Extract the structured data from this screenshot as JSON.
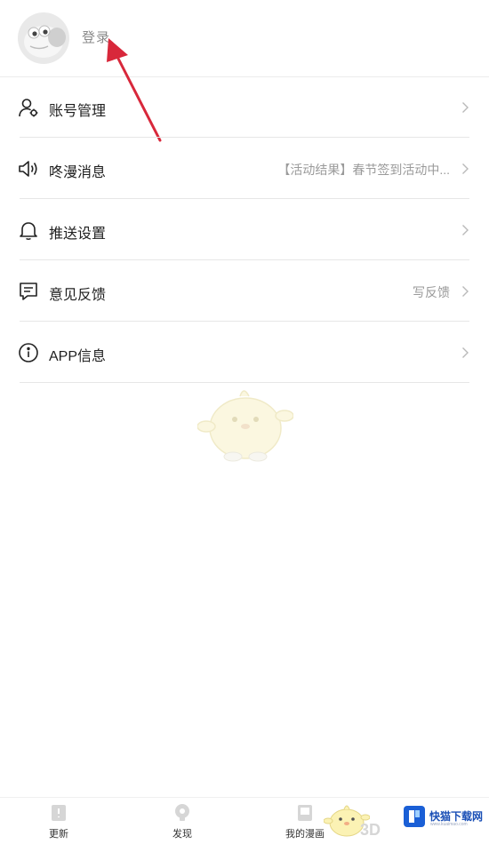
{
  "header": {
    "login_label": "登录"
  },
  "menu": [
    {
      "label": "账号管理",
      "icon": "user-settings-icon",
      "value": ""
    },
    {
      "label": "咚漫消息",
      "icon": "speaker-icon",
      "value": "【活动结果】春节签到活动中..."
    },
    {
      "label": "推送设置",
      "icon": "bell-icon",
      "value": ""
    },
    {
      "label": "意见反馈",
      "icon": "chat-message-icon",
      "value": "写反馈"
    },
    {
      "label": "APP信息",
      "icon": "info-icon",
      "value": ""
    }
  ],
  "tabbar": [
    {
      "label": "更新",
      "icon": "update-icon"
    },
    {
      "label": "发现",
      "icon": "discover-icon"
    },
    {
      "label": "我的漫画",
      "icon": "my-comics-icon"
    }
  ],
  "watermark": {
    "brand_text": "3D",
    "badge_title": "快猫下载网",
    "badge_subtitle": "www.kuaimao.com"
  },
  "colors": {
    "arrow": "#d8283b",
    "divider": "#e6e6e6",
    "secondary_text": "#9a9a9a",
    "badge_blue": "#1a4fb6"
  }
}
